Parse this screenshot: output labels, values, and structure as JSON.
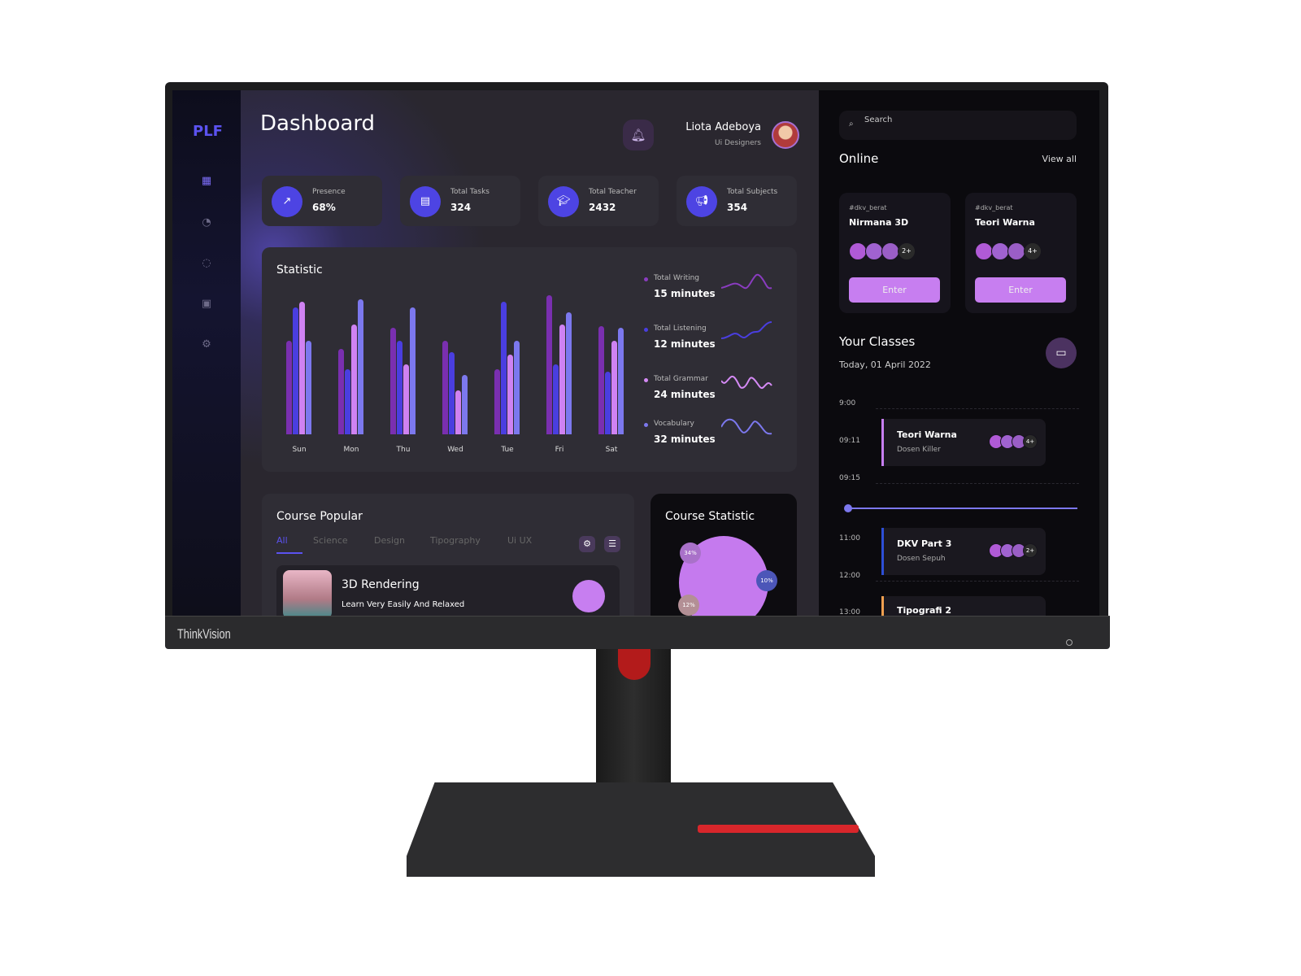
{
  "monitor": {
    "brand": "ThinkVision"
  },
  "sidebar": {
    "logo": "PLF",
    "items": [
      {
        "icon": "grid-icon"
      },
      {
        "icon": "pie-icon"
      },
      {
        "icon": "chat-icon"
      },
      {
        "icon": "wallet-icon"
      },
      {
        "icon": "settings-icon"
      }
    ]
  },
  "header": {
    "title": "Dashboard",
    "user_name": "Liota Adeboya",
    "user_role": "Ui Designers"
  },
  "stats": [
    {
      "label": "Presence",
      "value": "68%",
      "icon": "trend-icon"
    },
    {
      "label": "Total Tasks",
      "value": "324",
      "icon": "document-icon"
    },
    {
      "label": "Total Teacher",
      "value": "2432",
      "icon": "graduation-cap-icon"
    },
    {
      "label": "Total Subjects",
      "value": "354",
      "icon": "megaphone-icon"
    }
  ],
  "chart_data": {
    "type": "bar",
    "title": "Statistic",
    "categories": [
      "Sun",
      "Mon",
      "Thu",
      "Wed",
      "Tue",
      "Fri",
      "Sat"
    ],
    "series": [
      {
        "name": "Total Writing",
        "color": "#7a2fb0",
        "values": [
          66,
          60,
          75,
          66,
          46,
          98,
          76
        ]
      },
      {
        "name": "Total Listening",
        "color": "#4a3ee0",
        "values": [
          89,
          46,
          66,
          58,
          93,
          49,
          44
        ]
      },
      {
        "name": "Total Grammar",
        "color": "#cf82f2",
        "values": [
          93,
          77,
          49,
          31,
          56,
          77,
          66
        ]
      },
      {
        "name": "Vocabulary",
        "color": "#7c78ee",
        "values": [
          66,
          95,
          89,
          42,
          66,
          86,
          75
        ]
      }
    ]
  },
  "legend": [
    {
      "name": "Total Writing",
      "value": "15 minutes",
      "color": "#8a3cc0"
    },
    {
      "name": "Total Listening",
      "value": "12 minutes",
      "color": "#4a3ee0"
    },
    {
      "name": "Total Grammar",
      "value": "24 minutes",
      "color": "#d58af5"
    },
    {
      "name": "Vocabulary",
      "value": "32 minutes",
      "color": "#7c78ee"
    }
  ],
  "course_popular": {
    "title": "Course Popular",
    "tabs": [
      "All",
      "Science",
      "Design",
      "Tipography",
      "Ui UX"
    ],
    "active_tab": "All",
    "item": {
      "title": "3D Rendering",
      "subtitle": "Learn Very Easily And Relaxed"
    }
  },
  "course_statistic": {
    "title": "Course Statistic",
    "segments": [
      {
        "label": "34%"
      },
      {
        "label": "10%"
      },
      {
        "label": "12%"
      }
    ]
  },
  "right": {
    "search_placeholder": "Search",
    "online_title": "Online",
    "view_all": "View all",
    "online": [
      {
        "tag": "#dkv_berat",
        "title": "Nirmana 3D",
        "more": "2+",
        "button": "Enter"
      },
      {
        "tag": "#dkv_berat",
        "title": "Teori Warna",
        "more": "4+",
        "button": "Enter"
      }
    ],
    "classes_title": "Your Classes",
    "date": "Today, 01 April 2022",
    "times": [
      "9:00",
      "09:11",
      "09:15",
      "11:00",
      "12:00",
      "13:00"
    ],
    "classes": [
      {
        "title": "Teori Warna",
        "subtitle": "Dosen Killer",
        "more": "4+",
        "color": "#c77ef0"
      },
      {
        "title": "DKV Part 3",
        "subtitle": "Dosen Sepuh",
        "more": "2+",
        "color": "#2d4fd6"
      },
      {
        "title": "Tipografi 2",
        "subtitle": "",
        "more": "",
        "color": "#f0a050"
      }
    ]
  }
}
